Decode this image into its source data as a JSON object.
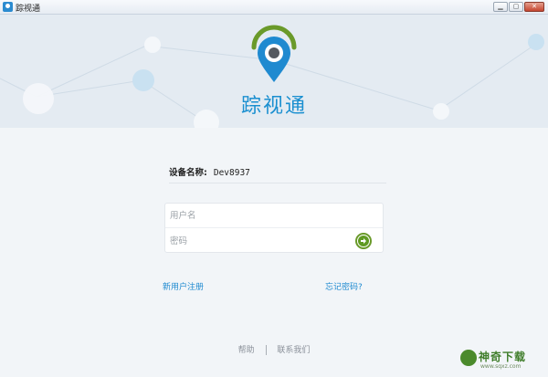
{
  "window": {
    "title": "踪视通",
    "controls": [
      "minimize",
      "maximize",
      "close"
    ]
  },
  "brand": {
    "name": "踪视通",
    "accent_color": "#1a8fd0",
    "logo_ring_color": "#6a9a2a",
    "logo_pin_color": "#1f8ad0"
  },
  "device": {
    "label": "设备名称:",
    "name": "Dev8937"
  },
  "login": {
    "username_placeholder": "用户名",
    "username_value": "",
    "password_placeholder": "密码",
    "password_value": "",
    "submit_icon": "arrow-right-icon"
  },
  "links": {
    "register": "新用户注册",
    "forgot_password": "忘记密码?"
  },
  "footer": {
    "help": "帮助",
    "contact": "联系我们"
  },
  "watermark": {
    "text": "神奇下载",
    "sub": "www.sqxz.com"
  }
}
